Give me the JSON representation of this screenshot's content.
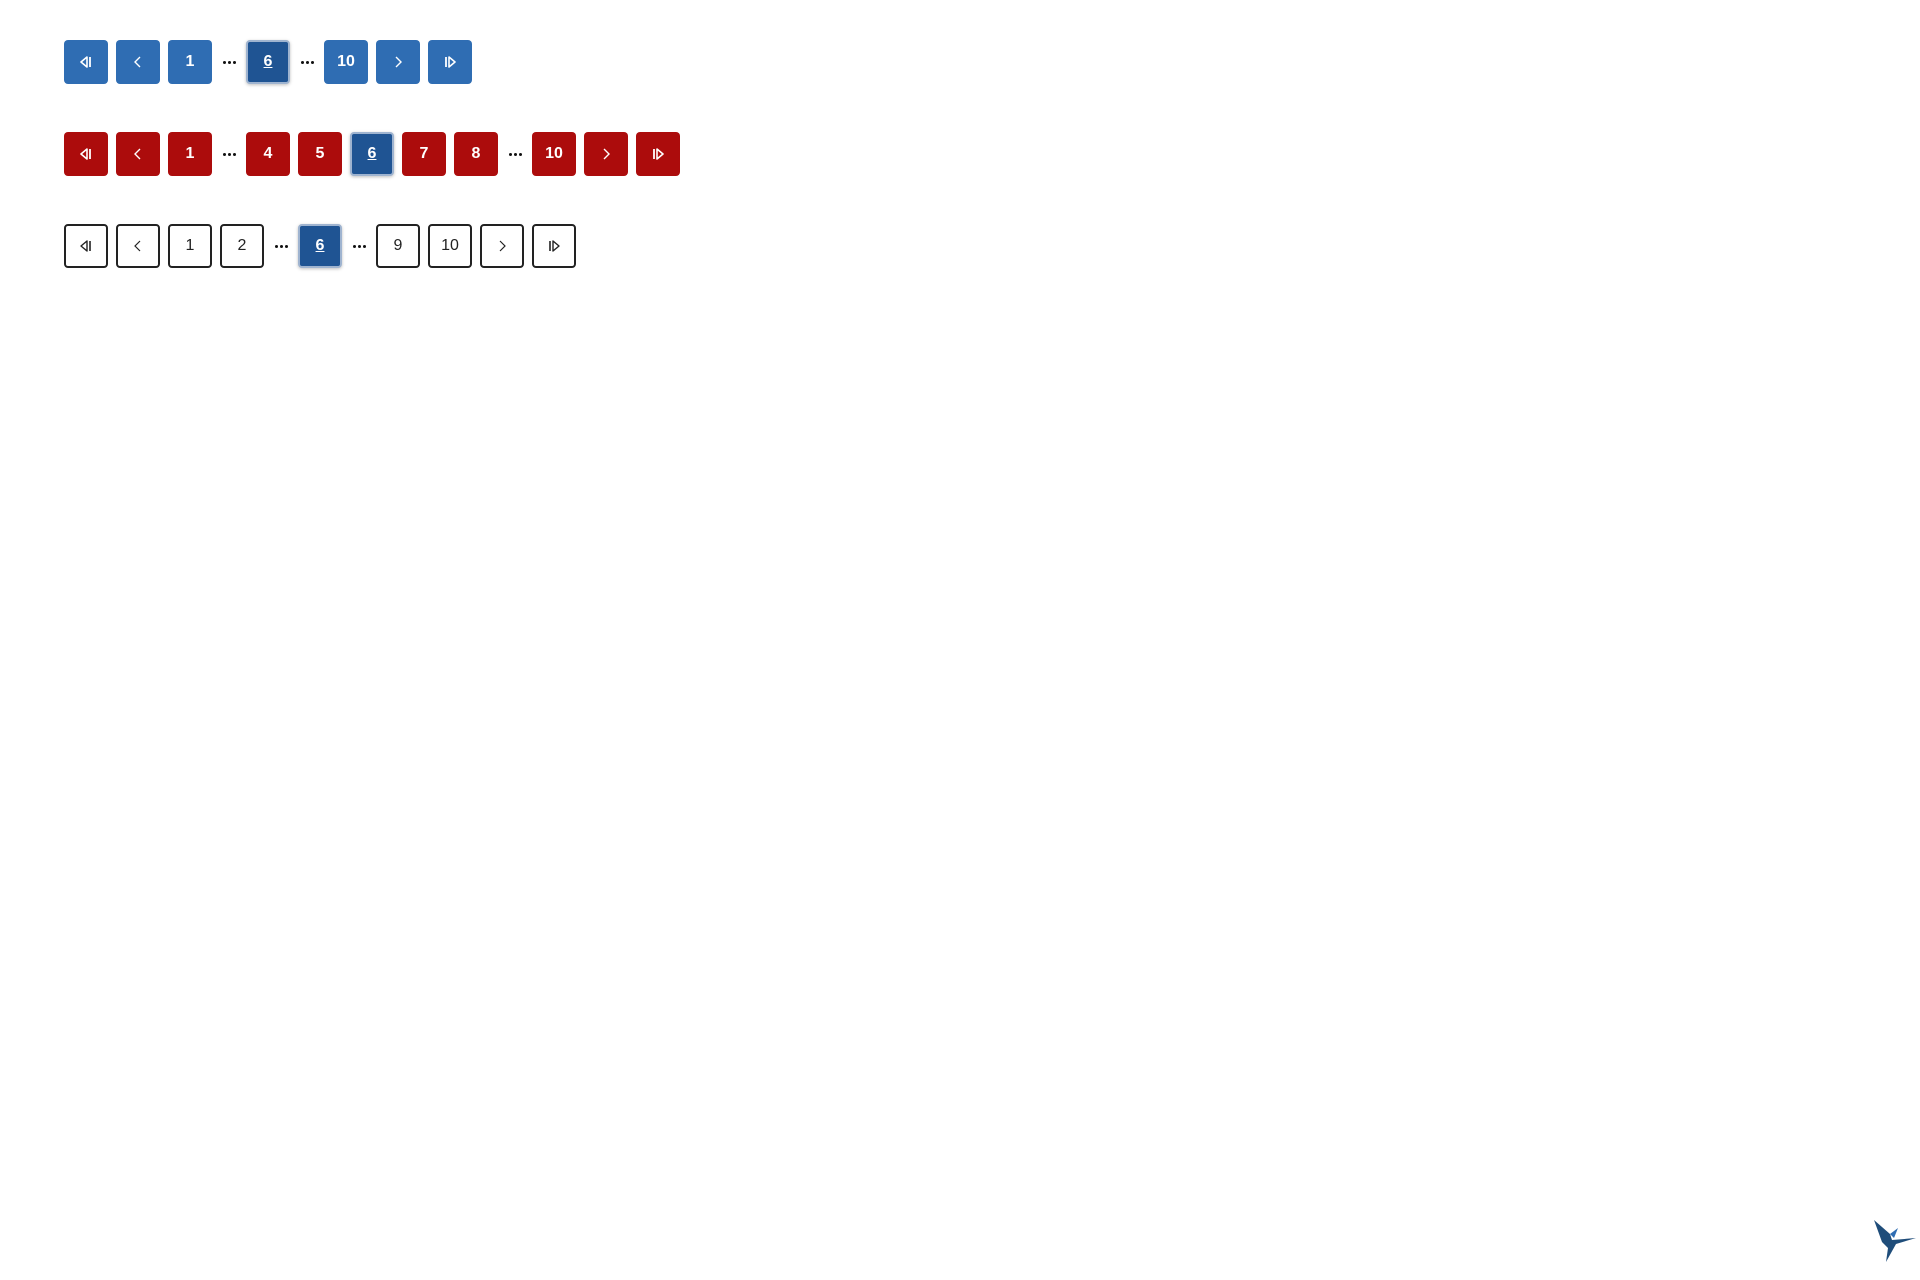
{
  "colors": {
    "blue_button": "#2f6db3",
    "red_button": "#ac0c0c",
    "current_page": "#1f5493",
    "outline_border": "#222222",
    "logo": "#1f4d7a"
  },
  "icons": {
    "first": "first-page-icon",
    "prev": "chevron-left-icon",
    "next": "chevron-right-icon",
    "last": "last-page-icon",
    "ellipsis": "ellipsis-icon",
    "logo": "hummingbird-logo-icon"
  },
  "pagers": {
    "blue": {
      "current": "6",
      "pages": {
        "p1": "1",
        "p6": "6",
        "p10": "10"
      }
    },
    "red": {
      "current": "6",
      "pages": {
        "p1": "1",
        "p4": "4",
        "p5": "5",
        "p6": "6",
        "p7": "7",
        "p8": "8",
        "p10": "10"
      }
    },
    "outline": {
      "current": "6",
      "pages": {
        "p1": "1",
        "p2": "2",
        "p6": "6",
        "p9": "9",
        "p10": "10"
      }
    }
  }
}
